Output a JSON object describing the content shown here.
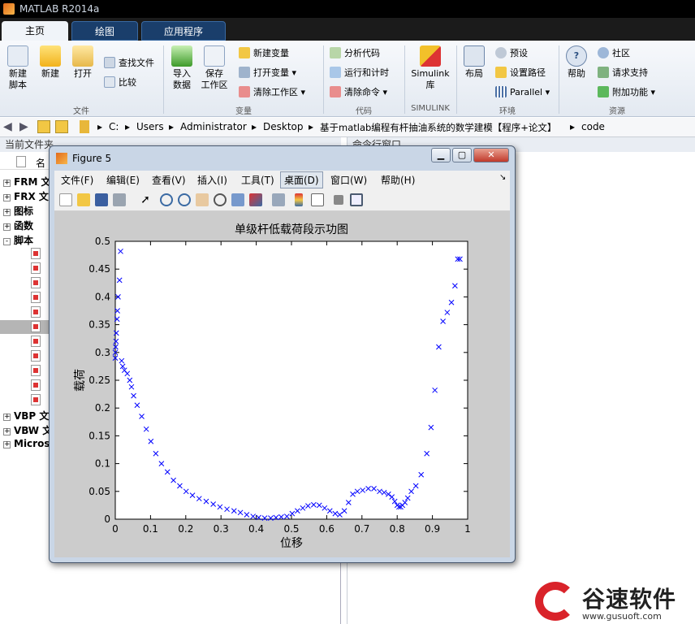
{
  "window": {
    "title": "MATLAB R2014a"
  },
  "tabs": [
    "主页",
    "绘图",
    "应用程序"
  ],
  "ribbon": {
    "file": {
      "new_script": "新建\n脚本",
      "new": "新建",
      "open": "打开",
      "find_files": "查找文件",
      "compare": "比较",
      "group": "文件"
    },
    "variable": {
      "import": "导入\n数据",
      "save_ws": "保存\n工作区",
      "new_var": "新建变量",
      "open_var": "打开变量",
      "clear_ws": "清除工作区",
      "group": "变量"
    },
    "code": {
      "analyze": "分析代码",
      "run_time": "运行和计时",
      "clear_cmd": "清除命令",
      "group": "代码"
    },
    "simulink": {
      "lib": "Simulink\n库",
      "group": "SIMULINK"
    },
    "env": {
      "layout": "布局",
      "prefs": "预设",
      "set_path": "设置路径",
      "parallel": "Parallel",
      "group": "环境"
    },
    "resources": {
      "help": "帮助",
      "community": "社区",
      "support": "请求支持",
      "addons": "附加功能",
      "group": "资源"
    }
  },
  "address": {
    "crumbs": [
      "C:",
      "Users",
      "Administrator",
      "Desktop",
      "基于matlab编程有杆抽油系统的数学建模【程序+论文】",
      "code"
    ]
  },
  "left_panel": {
    "title": "当前文件夹",
    "col_name": "名",
    "tree": [
      {
        "sign": "+",
        "label": "FRM 文"
      },
      {
        "sign": "+",
        "label": "FRX 文"
      },
      {
        "sign": "+",
        "label": "图标"
      },
      {
        "sign": "+",
        "label": "函数"
      },
      {
        "sign": "-",
        "label": "脚本"
      },
      {
        "sign": "+",
        "label": "VBP 文"
      },
      {
        "sign": "+",
        "label": "VBW 文"
      },
      {
        "sign": "+",
        "label": "Micros"
      }
    ]
  },
  "right_panel": {
    "title": "命令行窗口"
  },
  "figure": {
    "title": "Figure 5",
    "menu": [
      "文件(F)",
      "编辑(E)",
      "查看(V)",
      "插入(I)",
      "工具(T)",
      "桌面(D)",
      "窗口(W)",
      "帮助(H)"
    ],
    "menu_active": "桌面(D)"
  },
  "chart_data": {
    "type": "scatter",
    "title": "单级杆低载荷段示功图",
    "xlabel": "位移",
    "ylabel": "载荷",
    "xlim": [
      0,
      1
    ],
    "ylim": [
      0,
      0.5
    ],
    "xticks": [
      "0",
      "0.1",
      "0.2",
      "0.3",
      "0.4",
      "0.5",
      "0.6",
      "0.7",
      "0.8",
      "0.9",
      "1"
    ],
    "yticks": [
      "0",
      "0.05",
      "0.1",
      "0.15",
      "0.2",
      "0.25",
      "0.3",
      "0.35",
      "0.4",
      "0.45",
      "0.5"
    ],
    "marker": "x",
    "color": "#0000ff",
    "series": [
      {
        "x": [
          0.0,
          0.0,
          0.001,
          0.002,
          0.003,
          0.005,
          0.006,
          0.008,
          0.012,
          0.015,
          0.018,
          0.021,
          0.026,
          0.034,
          0.041,
          0.046,
          0.052,
          0.062,
          0.075,
          0.088,
          0.101,
          0.115,
          0.131,
          0.148,
          0.165,
          0.183,
          0.201,
          0.219,
          0.238,
          0.258,
          0.278,
          0.297,
          0.317,
          0.337,
          0.355,
          0.373,
          0.391,
          0.407,
          0.424,
          0.441,
          0.456,
          0.471,
          0.487,
          0.502,
          0.517,
          0.532,
          0.547,
          0.563,
          0.579,
          0.594,
          0.609,
          0.624,
          0.637,
          0.65,
          0.662,
          0.674,
          0.687,
          0.702,
          0.718,
          0.734,
          0.75,
          0.763,
          0.775,
          0.785,
          0.793,
          0.8,
          0.805,
          0.81,
          0.815,
          0.822,
          0.83,
          0.84,
          0.853,
          0.868,
          0.884,
          0.896,
          0.907,
          0.918,
          0.93,
          0.942,
          0.954,
          0.964,
          0.972,
          0.978
        ],
        "y": [
          0.29,
          0.3,
          0.31,
          0.32,
          0.335,
          0.36,
          0.375,
          0.4,
          0.43,
          0.482,
          0.285,
          0.275,
          0.268,
          0.262,
          0.25,
          0.238,
          0.222,
          0.205,
          0.185,
          0.162,
          0.14,
          0.118,
          0.1,
          0.085,
          0.07,
          0.06,
          0.05,
          0.043,
          0.037,
          0.032,
          0.027,
          0.022,
          0.018,
          0.015,
          0.012,
          0.008,
          0.005,
          0.003,
          0.002,
          0.002,
          0.003,
          0.004,
          0.005,
          0.01,
          0.015,
          0.02,
          0.024,
          0.026,
          0.025,
          0.02,
          0.015,
          0.01,
          0.008,
          0.015,
          0.03,
          0.045,
          0.05,
          0.052,
          0.055,
          0.055,
          0.05,
          0.048,
          0.045,
          0.04,
          0.032,
          0.025,
          0.022,
          0.022,
          0.025,
          0.03,
          0.038,
          0.05,
          0.06,
          0.08,
          0.118,
          0.165,
          0.232,
          0.31,
          0.356,
          0.372,
          0.39,
          0.42,
          0.468,
          0.468
        ]
      }
    ]
  },
  "watermark": {
    "brand": "谷速软件",
    "url": "www.gusuoft.com"
  },
  "colors": {
    "ribbon_tab_active": "#f0f4f9",
    "ribbon_tab": "#1a3e6b",
    "figure_bg": "#cccccc",
    "marker": "#0000ff"
  }
}
